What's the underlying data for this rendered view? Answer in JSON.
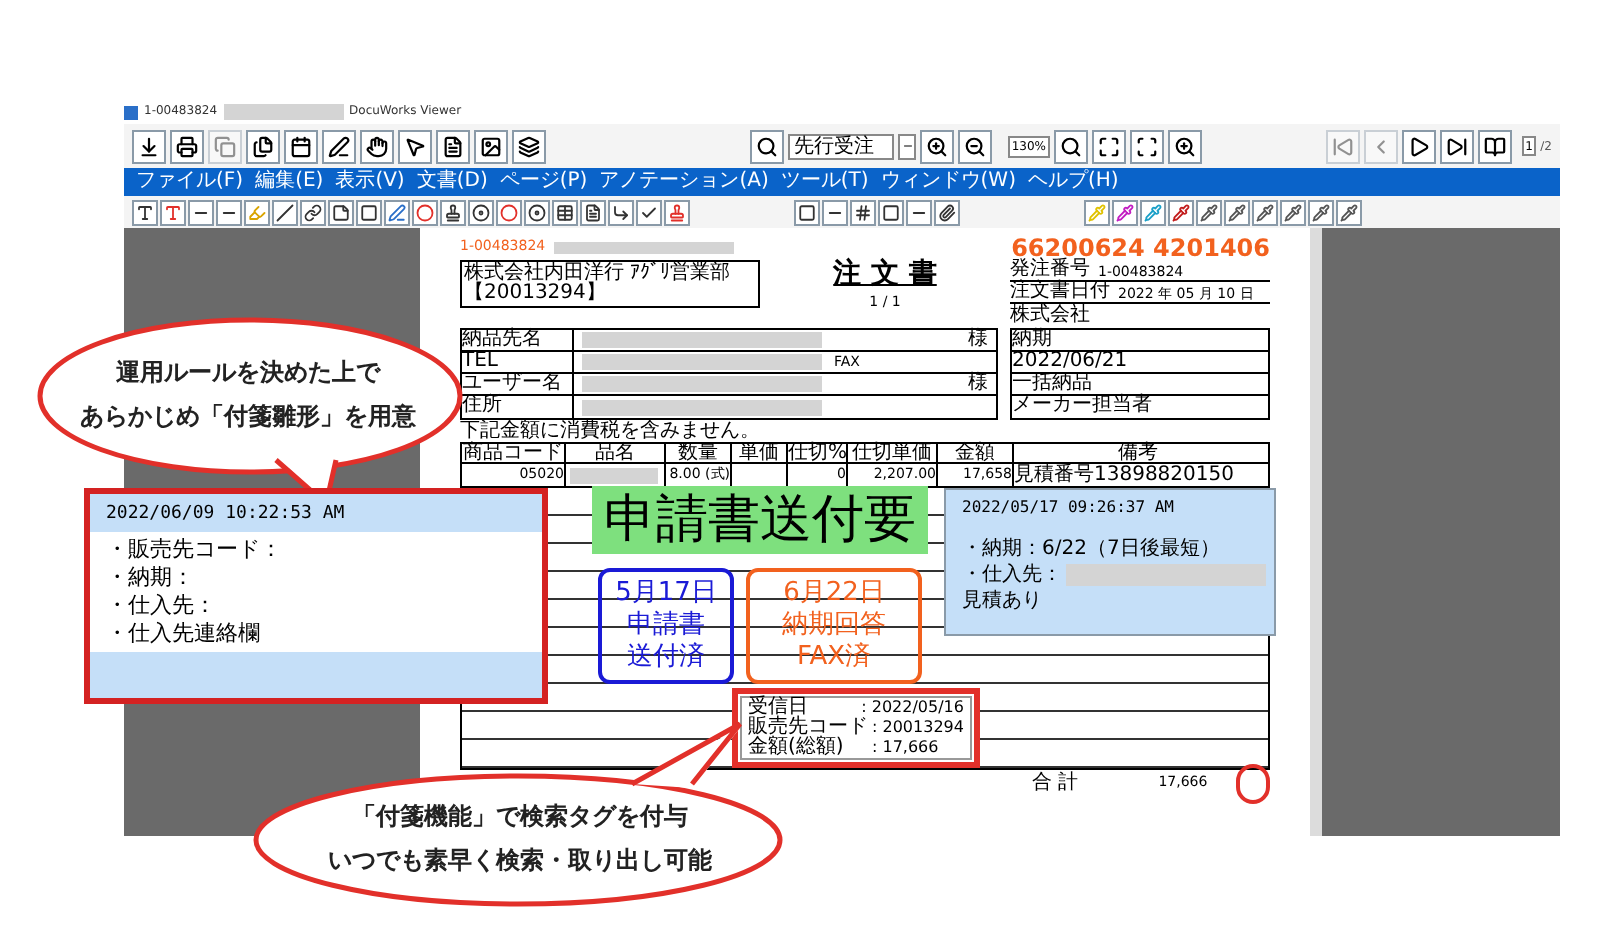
{
  "window": {
    "title_id": "1-00483824",
    "app_name": "DocuWorks Viewer"
  },
  "toolbar": {
    "search": {
      "value": "先行受注"
    },
    "zoom": {
      "value": "130%"
    },
    "page": {
      "value": "1",
      "total": "/2"
    }
  },
  "menu": [
    "ファイル(F)",
    "編集(E)",
    "表示(V)",
    "文書(D)",
    "ページ(P)",
    "アノテーション(A)",
    "ツール(T)",
    "ウィンドウ(W)",
    "ヘルプ(H)"
  ],
  "document": {
    "order_id": "1-00483824",
    "order_number": "66200624 4201406",
    "customer": "株式会社内田洋行 ｱｸﾞﾘ営業部",
    "customer_code": "【20013294】",
    "title": "注 文 書",
    "page_count": "1 / 1",
    "info": [
      {
        "label": "発注番号",
        "value": "1-00483824"
      },
      {
        "label": "注文書日付",
        "value": "2022 年 05 月 10 日"
      }
    ],
    "supplier": "株式会社",
    "left_rows": [
      {
        "label": "納品先名",
        "suffix": "様"
      },
      {
        "label": "TEL",
        "mid": "FAX"
      },
      {
        "label": "ユーザー名",
        "suffix": "様"
      },
      {
        "label": "住所"
      }
    ],
    "right_rows": [
      "納期",
      "2022/06/21",
      "一括納品",
      "メーカー担当者"
    ],
    "note": "下記金額に消費税を含みません。",
    "columns": [
      "商品コード",
      "品名",
      "数量",
      "単価",
      "仕切%",
      "仕切単価",
      "金額",
      "備考"
    ],
    "row": [
      {
        "kind": "text",
        "text": "05020"
      },
      {
        "kind": "redacted"
      },
      {
        "kind": "text",
        "text": "8.00 (式)"
      },
      {
        "kind": "blank"
      },
      {
        "kind": "text",
        "text": "0"
      },
      {
        "kind": "text",
        "text": "2,207.00"
      },
      {
        "kind": "text",
        "text": "17,658"
      },
      {
        "kind": "text",
        "text": "見積番号13898820150"
      }
    ],
    "total": {
      "label": "合 計",
      "value": "17,666"
    }
  },
  "annotations": {
    "left_note": {
      "timestamp": "2022/06/09 10:22:53 AM",
      "lines": [
        "・販売先コード：",
        "・納期：",
        "・仕入先：",
        "・仕入先連絡欄"
      ]
    },
    "stamp_text": "申請書送付要",
    "boxes": [
      {
        "lines": [
          "5月17日",
          "申請書",
          "送付済"
        ],
        "color": "#1a1ad6"
      },
      {
        "lines": [
          "6月22日",
          "納期回答",
          "FAX済"
        ],
        "color": "#f2611e"
      }
    ],
    "right_note": {
      "timestamp": "2022/05/17 09:26:37 AM",
      "lines": [
        {
          "kind": "text",
          "text": "・納期：6/22（7日後最短）"
        },
        {
          "kind": "with_redaction",
          "text": "・仕入先："
        },
        {
          "kind": "text",
          "text": "見積あり"
        }
      ]
    },
    "tag": [
      {
        "label": "受信日",
        "value": ": 2022/05/16"
      },
      {
        "label": "販売先コード",
        "value": ": 20013294"
      },
      {
        "label": "金額(総額)",
        "value": ": 17,666"
      }
    ]
  },
  "callouts": [
    {
      "lines": [
        "運用ルールを決めた上で",
        "あらかじめ「付箋雛形」を用意"
      ]
    },
    {
      "lines": [
        "「付箋機能」で検索タグを付与",
        "いつでも素早く検索・取り出し可能"
      ]
    }
  ]
}
